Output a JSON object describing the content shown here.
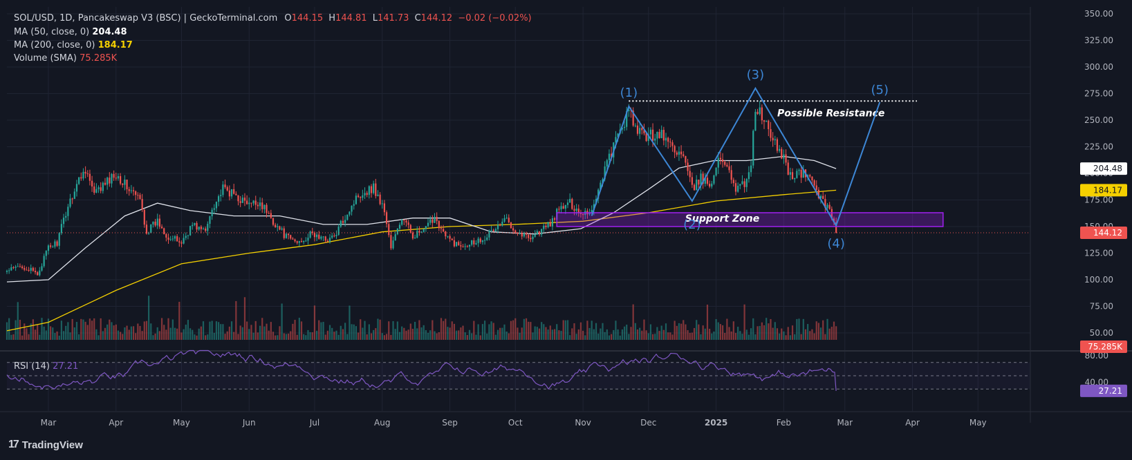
{
  "header": {
    "symbol": "SOL/USD, 1D, Pancakeswap V3 (BSC) | GeckoTerminal.com",
    "o_label": "O",
    "o_value": "144.15",
    "h_label": "H",
    "h_value": "144.81",
    "l_label": "L",
    "l_value": "141.73",
    "c_label": "C",
    "c_value": "144.12",
    "change": "−0.02 (−0.02%)",
    "ma50_label": "MA (50, close, 0)",
    "ma50_value": "204.48",
    "ma200_label": "MA (200, close, 0)",
    "ma200_value": "184.17",
    "volume_label": "Volume (SMA)",
    "volume_value": "75.285K",
    "rsi_label": "RSI (14)",
    "rsi_value": "27.21"
  },
  "brand": {
    "label": "TradingView"
  },
  "colors": {
    "background": "#131722",
    "up": "#26a69a",
    "down": "#ef5350",
    "ma50": "#e0e3eb",
    "ma200": "#f5d000",
    "rsi": "#7e57c2",
    "annotation": "#3d87d6",
    "support_zone": "#a020f0",
    "text": "#b2b5be"
  },
  "chart_data": {
    "type": "candlestick",
    "price_axis": {
      "ticks": [
        "350.00",
        "325.00",
        "300.00",
        "275.00",
        "250.00",
        "225.00",
        "200.00",
        "175.00",
        "150.00",
        "125.00",
        "100.00",
        "75.00",
        "50.00"
      ],
      "ylim": [
        50,
        350
      ]
    },
    "x_axis": {
      "ticks": [
        "Mar",
        "Apr",
        "May",
        "Jun",
        "Jul",
        "Aug",
        "Sep",
        "Oct",
        "Nov",
        "Dec",
        "2025",
        "Feb",
        "Mar",
        "Apr",
        "May"
      ],
      "range": [
        "2024-02-11",
        "2025-05-25"
      ]
    },
    "ohlc_anchor_closes": [
      [
        "2024-02-11",
        108
      ],
      [
        "2024-02-18",
        113
      ],
      [
        "2024-02-25",
        105
      ],
      [
        "2024-03-01",
        130
      ],
      [
        "2024-03-05",
        135
      ],
      [
        "2024-03-10",
        170
      ],
      [
        "2024-03-14",
        190
      ],
      [
        "2024-03-18",
        205
      ],
      [
        "2024-03-22",
        180
      ],
      [
        "2024-03-27",
        190
      ],
      [
        "2024-04-01",
        200
      ],
      [
        "2024-04-07",
        185
      ],
      [
        "2024-04-12",
        175
      ],
      [
        "2024-04-15",
        145
      ],
      [
        "2024-04-20",
        155
      ],
      [
        "2024-04-25",
        140
      ],
      [
        "2024-05-01",
        135
      ],
      [
        "2024-05-06",
        152
      ],
      [
        "2024-05-12",
        145
      ],
      [
        "2024-05-15",
        168
      ],
      [
        "2024-05-20",
        185
      ],
      [
        "2024-05-25",
        180
      ],
      [
        "2024-06-01",
        170
      ],
      [
        "2024-06-06",
        173
      ],
      [
        "2024-06-12",
        155
      ],
      [
        "2024-06-18",
        140
      ],
      [
        "2024-06-23",
        135
      ],
      [
        "2024-06-30",
        143
      ],
      [
        "2024-07-05",
        138
      ],
      [
        "2024-07-10",
        140
      ],
      [
        "2024-07-15",
        160
      ],
      [
        "2024-07-21",
        180
      ],
      [
        "2024-07-28",
        187
      ],
      [
        "2024-08-02",
        165
      ],
      [
        "2024-08-05",
        130
      ],
      [
        "2024-08-10",
        158
      ],
      [
        "2024-08-15",
        142
      ],
      [
        "2024-08-20",
        145
      ],
      [
        "2024-08-25",
        160
      ],
      [
        "2024-08-30",
        140
      ],
      [
        "2024-09-05",
        132
      ],
      [
        "2024-09-10",
        135
      ],
      [
        "2024-09-15",
        138
      ],
      [
        "2024-09-20",
        145
      ],
      [
        "2024-09-27",
        157
      ],
      [
        "2024-10-02",
        145
      ],
      [
        "2024-10-07",
        140
      ],
      [
        "2024-10-12",
        145
      ],
      [
        "2024-10-17",
        153
      ],
      [
        "2024-10-21",
        166
      ],
      [
        "2024-10-26",
        172
      ],
      [
        "2024-10-31",
        163
      ],
      [
        "2024-11-05",
        165
      ],
      [
        "2024-11-11",
        205
      ],
      [
        "2024-11-16",
        230
      ],
      [
        "2024-11-22",
        258
      ],
      [
        "2024-11-26",
        238
      ],
      [
        "2024-12-01",
        235
      ],
      [
        "2024-12-06",
        238
      ],
      [
        "2024-12-12",
        225
      ],
      [
        "2024-12-17",
        215
      ],
      [
        "2024-12-21",
        185
      ],
      [
        "2024-12-25",
        195
      ],
      [
        "2024-12-29",
        190
      ],
      [
        "2025-01-03",
        215
      ],
      [
        "2025-01-07",
        205
      ],
      [
        "2025-01-10",
        185
      ],
      [
        "2025-01-14",
        190
      ],
      [
        "2025-01-17",
        210
      ],
      [
        "2025-01-19",
        262
      ],
      [
        "2025-01-23",
        250
      ],
      [
        "2025-01-27",
        230
      ],
      [
        "2025-02-01",
        215
      ],
      [
        "2025-02-04",
        198
      ],
      [
        "2025-02-09",
        200
      ],
      [
        "2025-02-14",
        195
      ],
      [
        "2025-02-18",
        175
      ],
      [
        "2025-02-22",
        168
      ],
      [
        "2025-02-25",
        144
      ]
    ],
    "ma50_points": [
      [
        "2024-02-11",
        98
      ],
      [
        "2024-03-01",
        100
      ],
      [
        "2024-03-18",
        130
      ],
      [
        "2024-04-05",
        160
      ],
      [
        "2024-04-20",
        172
      ],
      [
        "2024-05-05",
        165
      ],
      [
        "2024-05-25",
        160
      ],
      [
        "2024-06-15",
        160
      ],
      [
        "2024-07-05",
        152
      ],
      [
        "2024-07-25",
        152
      ],
      [
        "2024-08-15",
        158
      ],
      [
        "2024-09-01",
        158
      ],
      [
        "2024-09-20",
        145
      ],
      [
        "2024-10-10",
        143
      ],
      [
        "2024-10-31",
        148
      ],
      [
        "2024-11-15",
        163
      ],
      [
        "2024-12-01",
        185
      ],
      [
        "2024-12-15",
        205
      ],
      [
        "2024-12-31",
        212
      ],
      [
        "2025-01-15",
        212
      ],
      [
        "2025-02-01",
        216
      ],
      [
        "2025-02-15",
        212
      ],
      [
        "2025-02-25",
        204.48
      ]
    ],
    "ma200_points": [
      [
        "2024-02-11",
        52
      ],
      [
        "2024-03-01",
        60
      ],
      [
        "2024-04-01",
        90
      ],
      [
        "2024-05-01",
        115
      ],
      [
        "2024-06-01",
        125
      ],
      [
        "2024-07-01",
        133
      ],
      [
        "2024-08-01",
        145
      ],
      [
        "2024-09-01",
        150
      ],
      [
        "2024-10-01",
        152
      ],
      [
        "2024-11-01",
        155
      ],
      [
        "2024-12-01",
        163
      ],
      [
        "2025-01-01",
        174
      ],
      [
        "2025-02-01",
        180
      ],
      [
        "2025-02-25",
        184.17
      ]
    ],
    "volume_axis_label": "75.285K",
    "rsi": {
      "ticks": [
        "80.00",
        "40.00"
      ],
      "levels": [
        70,
        50,
        30
      ],
      "value": 27.21
    },
    "current_price": 144.12,
    "annotations": {
      "waves": [
        {
          "label": "(1)",
          "date": "2024-11-22",
          "price": 263
        },
        {
          "label": "(2)",
          "date": "2024-12-21",
          "price": 174
        },
        {
          "label": "(3)",
          "date": "2025-01-19",
          "price": 280
        },
        {
          "label": "(4)",
          "date": "2025-02-25",
          "price": 151
        },
        {
          "label": "(5)",
          "date": "2025-03-17",
          "price": 267
        }
      ],
      "resistance": {
        "label": "Possible Resistance",
        "price": 268,
        "from": "2024-11-22",
        "to": "2025-04-03"
      },
      "support_zone": {
        "label": "Support Zone",
        "top": 163,
        "bottom": 150,
        "from": "2024-10-20",
        "to": "2025-04-15"
      }
    }
  }
}
